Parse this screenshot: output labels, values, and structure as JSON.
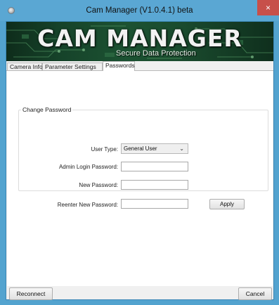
{
  "window": {
    "title": "Cam Manager (V1.0.4.1) beta",
    "close_glyph": "×",
    "app_icon": "app-circle-icon"
  },
  "banner": {
    "logo_text": "CAM MANAGER",
    "tagline": "Secure Data Protection"
  },
  "tabs": [
    {
      "label": "Camera Info",
      "active": false
    },
    {
      "label": "Parameter Settings",
      "active": false
    },
    {
      "label": "Passwords",
      "active": true
    }
  ],
  "change_password": {
    "group_title": "Change Password",
    "user_type_label": "User Type:",
    "user_type_value": "General User",
    "admin_password_label": "Admin Login Password:",
    "admin_password_value": "",
    "new_password_label": "New Password:",
    "new_password_value": "",
    "reenter_password_label": "Reenter New Password:",
    "reenter_password_value": "",
    "apply_label": "Apply"
  },
  "footer": {
    "reconnect_label": "Reconnect",
    "cancel_label": "Cancel"
  },
  "colors": {
    "titlebar": "#5aa7d3",
    "close_button": "#c7504a",
    "banner": "#1c5232"
  }
}
